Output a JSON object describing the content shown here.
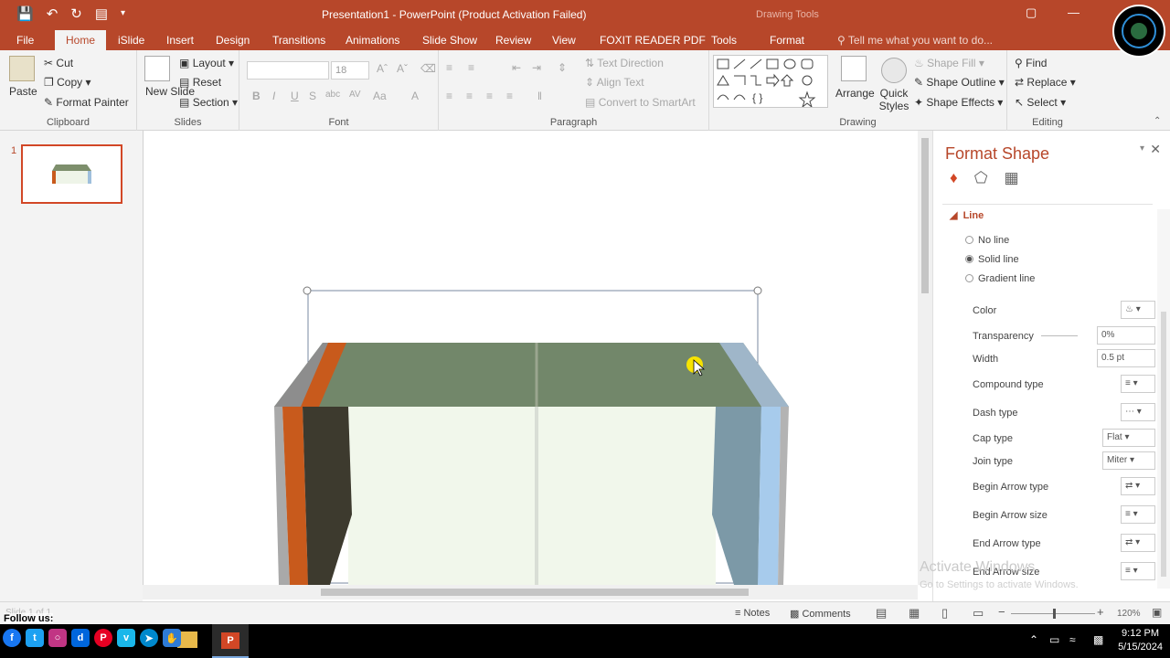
{
  "window": {
    "title": "Presentation1 - PowerPoint (Product Activation Failed)",
    "contextual_tab_group": "Drawing Tools"
  },
  "tabs": [
    "File",
    "Home",
    "iSlide",
    "Insert",
    "Design",
    "Transitions",
    "Animations",
    "Slide Show",
    "Review",
    "View",
    "FOXIT READER PDF",
    "Tools",
    "Format"
  ],
  "active_tab": "Home",
  "tell_me": "Tell me what you want to do...",
  "ribbon": {
    "clipboard": {
      "name": "Clipboard",
      "paste": "Paste",
      "cut": "Cut",
      "copy": "Copy",
      "format_painter": "Format Painter"
    },
    "slides": {
      "name": "Slides",
      "new_slide": "New Slide",
      "layout": "Layout",
      "reset": "Reset",
      "section": "Section"
    },
    "font": {
      "name": "Font",
      "size": "18"
    },
    "paragraph": {
      "name": "Paragraph",
      "text_direction": "Text Direction",
      "align_text": "Align Text",
      "convert_smartart": "Convert to SmartArt"
    },
    "drawing": {
      "name": "Drawing",
      "arrange": "Arrange",
      "quick_styles": "Quick Styles",
      "shape_fill": "Shape Fill",
      "shape_outline": "Shape Outline",
      "shape_effects": "Shape Effects"
    },
    "editing": {
      "name": "Editing",
      "find": "Find",
      "replace": "Replace",
      "select": "Select"
    }
  },
  "slides_panel": {
    "slide_number": "1"
  },
  "format_pane": {
    "title": "Format Shape",
    "section": "Line",
    "options": [
      "No line",
      "Solid line",
      "Gradient line"
    ],
    "selected_option": "Solid line",
    "props": {
      "color": "Color",
      "transparency": "Transparency",
      "transparency_value": "0%",
      "width": "Width",
      "width_value": "0.5 pt",
      "compound": "Compound type",
      "dash": "Dash type",
      "cap": "Cap type",
      "cap_value": "Flat",
      "join": "Join type",
      "join_value": "Miter",
      "begin_arrow_type": "Begin Arrow type",
      "begin_arrow_size": "Begin Arrow size",
      "end_arrow_type": "End Arrow type",
      "end_arrow_size": "End Arrow size"
    }
  },
  "watermark": {
    "line1": "Activate Windows",
    "line2": "Go to Settings to activate Windows."
  },
  "statusbar": {
    "slide_info": "Slide 1 of 1",
    "notes": "Notes",
    "comments": "Comments",
    "zoom": "120%"
  },
  "taskbar": {
    "time": "9:12 PM",
    "date": "5/15/2024"
  },
  "overlay": {
    "follow": "Follow us:"
  },
  "colors": {
    "accent": "#b7472a",
    "ribbon": "#f3f3f3"
  }
}
